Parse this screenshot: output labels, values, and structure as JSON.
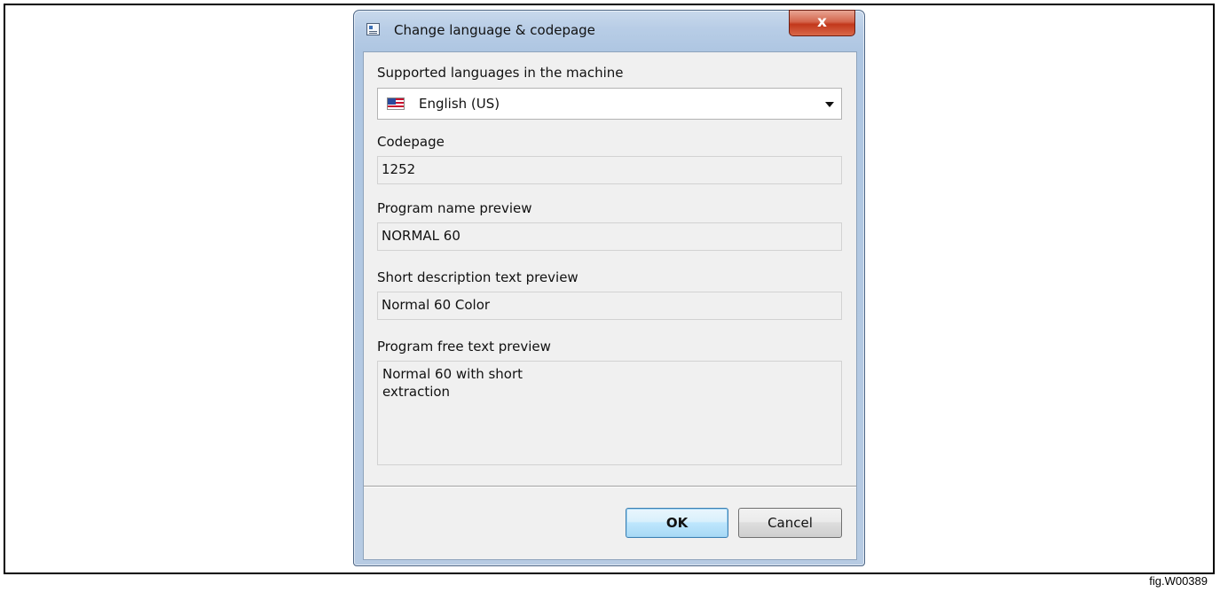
{
  "window": {
    "title": "Change language & codepage",
    "close_glyph": "x"
  },
  "fields": {
    "languages_label": "Supported languages in the machine",
    "language_value": "English (US)",
    "language_flag_icon": "us-flag-icon",
    "codepage_label": "Codepage",
    "codepage_value": "1252",
    "program_name_label": "Program name preview",
    "program_name_value": "NORMAL 60",
    "short_desc_label": "Short description text preview",
    "short_desc_value": "Normal 60 Color",
    "free_text_label": "Program free text preview",
    "free_text_lines": [
      "Normal 60 with short",
      "extraction"
    ]
  },
  "buttons": {
    "ok_label": "OK",
    "cancel_label": "Cancel"
  },
  "caption": "fig.W00389"
}
